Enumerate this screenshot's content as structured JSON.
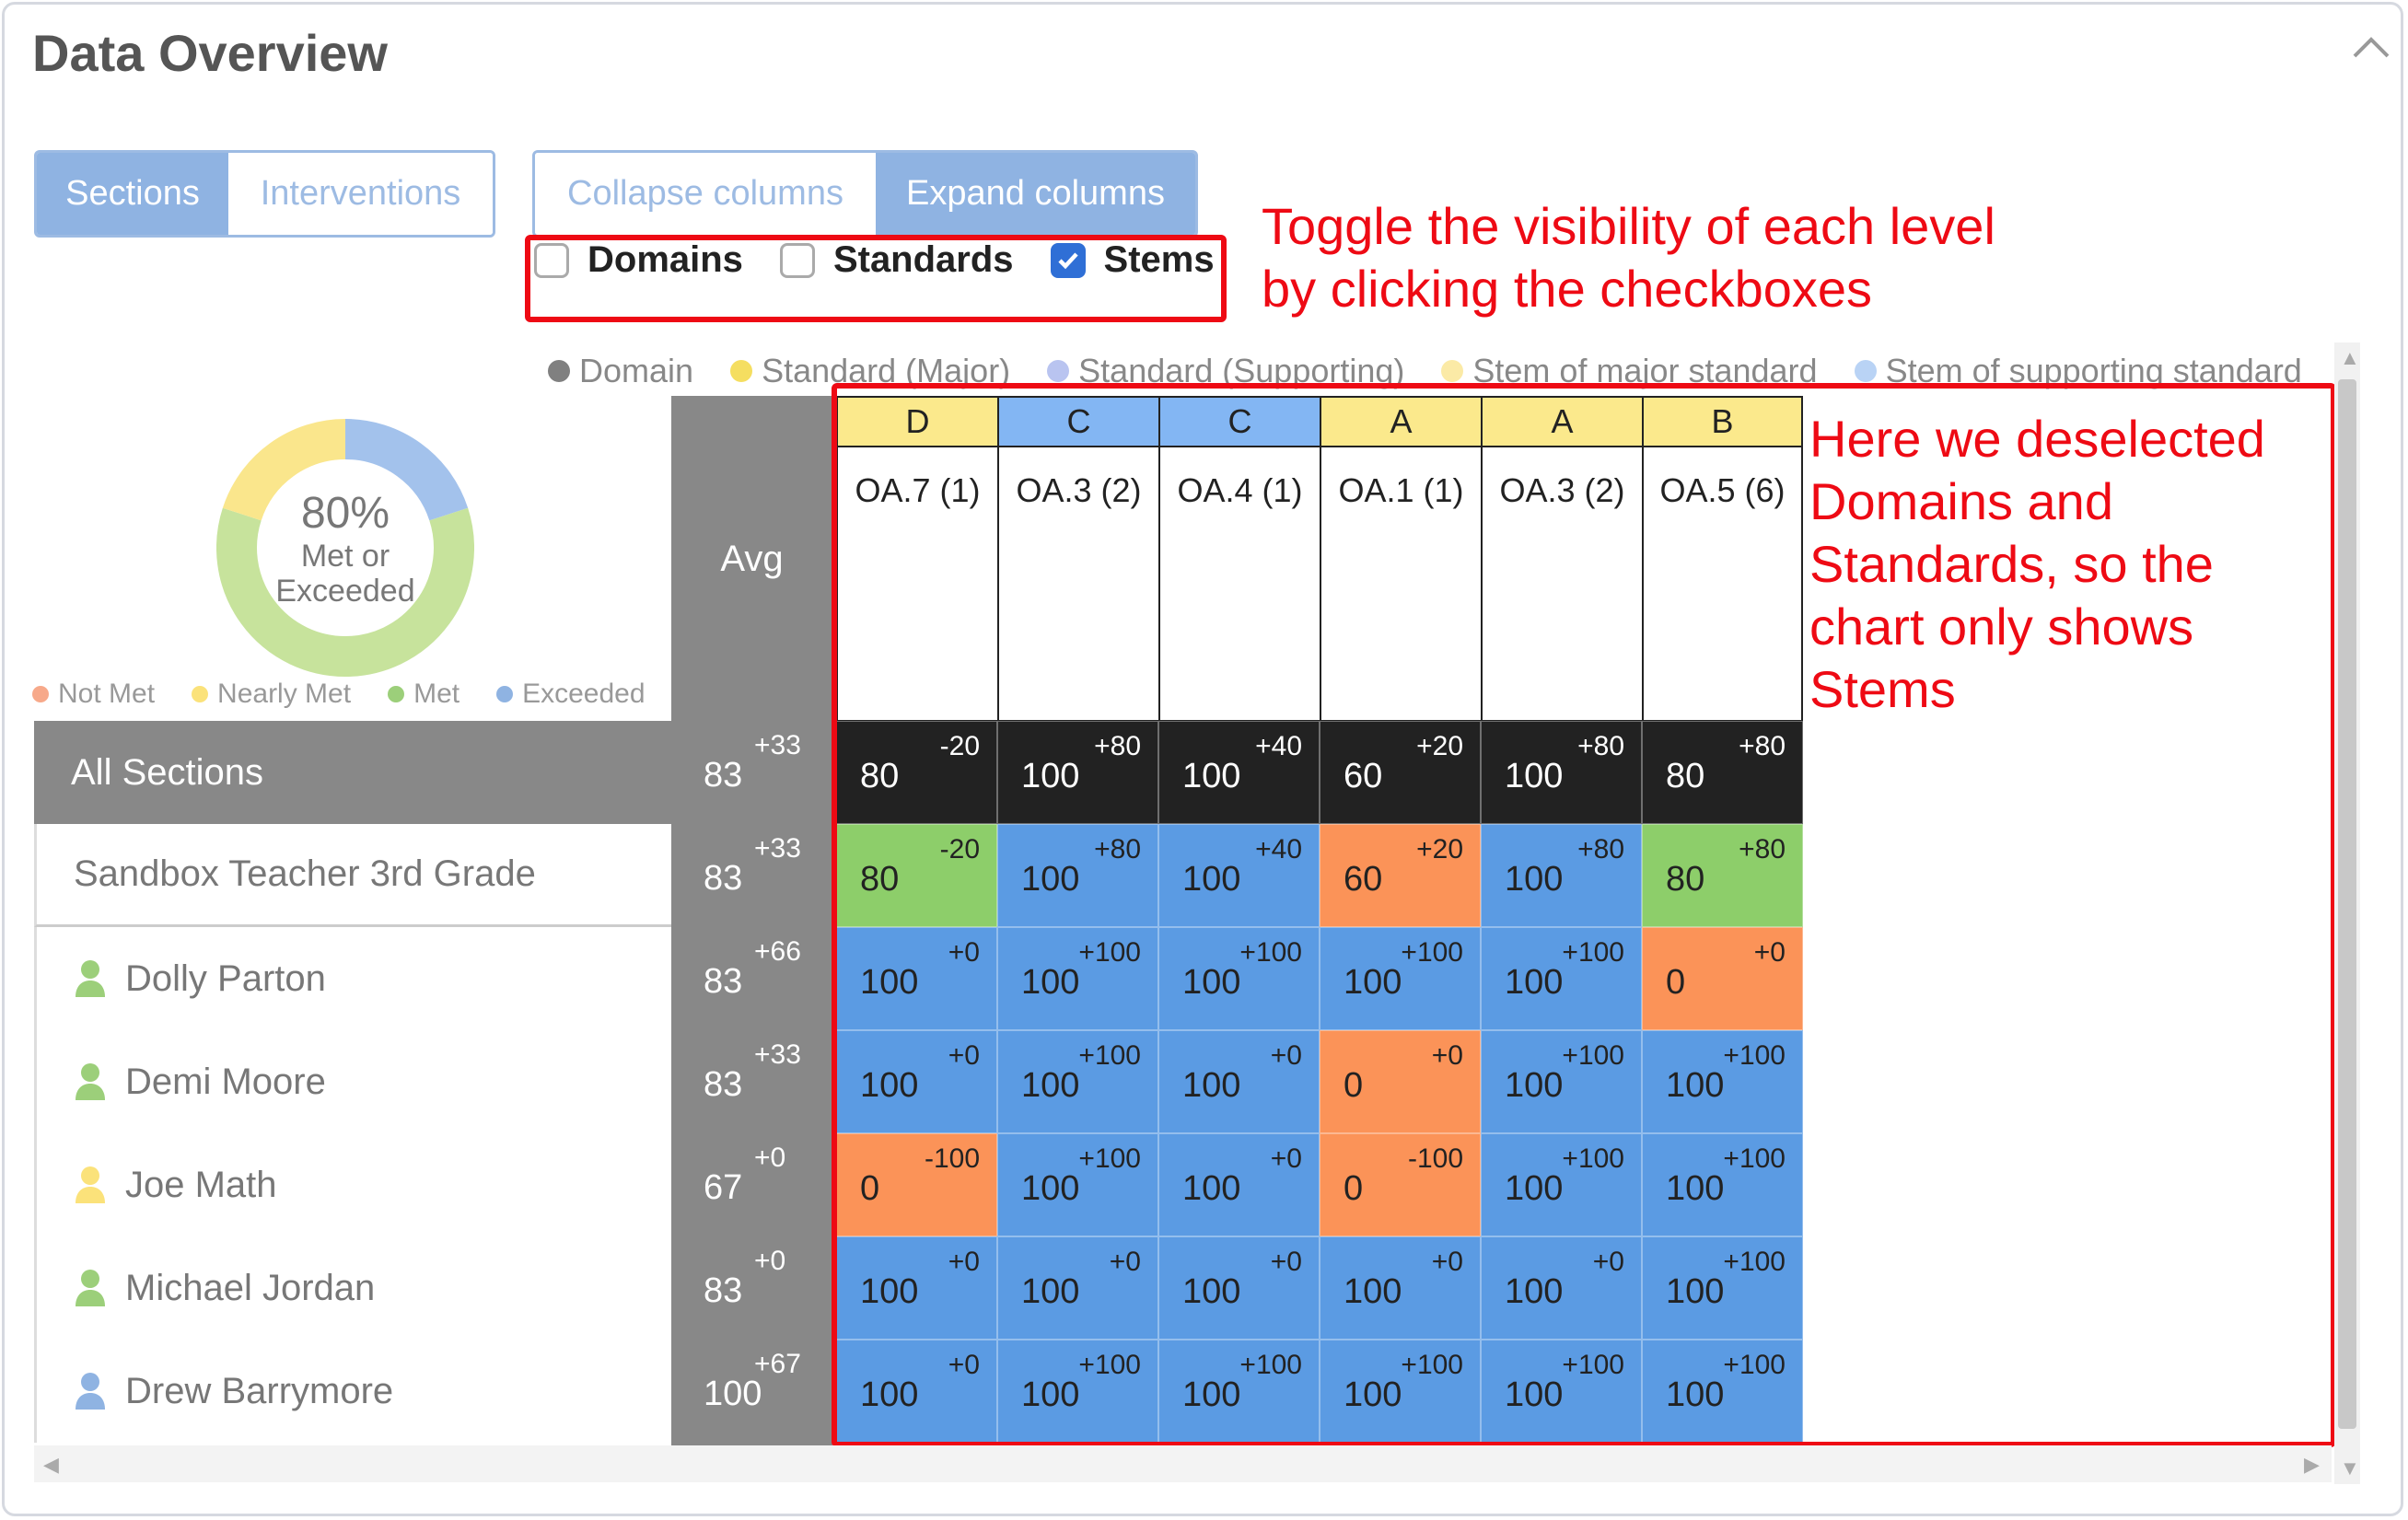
{
  "title": "Data Overview",
  "view_tabs": [
    {
      "label": "Sections",
      "active": true
    },
    {
      "label": "Interventions",
      "active": false
    }
  ],
  "column_tabs": [
    {
      "label": "Collapse columns",
      "active": false
    },
    {
      "label": "Expand columns",
      "active": true
    }
  ],
  "checkboxes": [
    {
      "label": "Domains",
      "checked": false
    },
    {
      "label": "Standards",
      "checked": false
    },
    {
      "label": "Stems",
      "checked": true
    }
  ],
  "annotations": {
    "toggle_line1": "Toggle the visibility of each level",
    "toggle_line2": "by clicking the checkboxes",
    "chart_lines": [
      "Here we deselected",
      "Domains and",
      "Standards, so the",
      "chart only shows",
      "Stems"
    ]
  },
  "level_legend": [
    {
      "label": "Domain",
      "color": "#808080"
    },
    {
      "label": "Standard (Major)",
      "color": "#f5de60"
    },
    {
      "label": "Standard (Supporting)",
      "color": "#b9c4f0"
    },
    {
      "label": "Stem of major standard",
      "color": "#fbeaa6"
    },
    {
      "label": "Stem of supporting standard",
      "color": "#b9d3f5"
    }
  ],
  "donut": {
    "percent_label": "80%",
    "sub_line1": "Met or",
    "sub_line2": "Exceeded",
    "segments": [
      {
        "name": "Exceeded",
        "fraction": 0.2,
        "color": "#a3c2ec"
      },
      {
        "name": "Met",
        "fraction": 0.6,
        "color": "#c7e39c"
      },
      {
        "name": "Nearly Met",
        "fraction": 0.2,
        "color": "#fae68c"
      }
    ]
  },
  "donut_legend": [
    {
      "label": "Not Met",
      "color": "#f7a98a"
    },
    {
      "label": "Nearly Met",
      "color": "#fbe27a"
    },
    {
      "label": "Met",
      "color": "#9ccf7a"
    },
    {
      "label": "Exceeded",
      "color": "#8fb3e2"
    }
  ],
  "avg_header": "Avg",
  "colors": {
    "met": "#8dce6a",
    "exceeded": "#5b9be3",
    "not_met": "#fb9358",
    "all_sections_row": "#222222",
    "header_yellow": "#fbe98c",
    "header_blue": "#83b6f3"
  },
  "columns": [
    {
      "letter": "D",
      "stem": "OA.7 (1)",
      "header_color": "#fbe98c"
    },
    {
      "letter": "C",
      "stem": "OA.3 (2)",
      "header_color": "#83b6f3"
    },
    {
      "letter": "C",
      "stem": "OA.4 (1)",
      "header_color": "#83b6f3"
    },
    {
      "letter": "A",
      "stem": "OA.1 (1)",
      "header_color": "#fbe98c"
    },
    {
      "letter": "A",
      "stem": "OA.3 (2)",
      "header_color": "#fbe98c"
    },
    {
      "letter": "B",
      "stem": "OA.5 (6)",
      "header_color": "#fbe98c"
    }
  ],
  "rows": [
    {
      "name": "All Sections",
      "kind": "all",
      "avg": "83",
      "avg_delta": "+33",
      "cells": [
        {
          "v": "80",
          "d": "-20",
          "s": "all"
        },
        {
          "v": "100",
          "d": "+80",
          "s": "all"
        },
        {
          "v": "100",
          "d": "+40",
          "s": "all"
        },
        {
          "v": "60",
          "d": "+20",
          "s": "all"
        },
        {
          "v": "100",
          "d": "+80",
          "s": "all"
        },
        {
          "v": "80",
          "d": "+80",
          "s": "all"
        }
      ]
    },
    {
      "name": "Sandbox Teacher 3rd Grade",
      "kind": "section",
      "avg": "83",
      "avg_delta": "+33",
      "cells": [
        {
          "v": "80",
          "d": "-20",
          "s": "met"
        },
        {
          "v": "100",
          "d": "+80",
          "s": "exceeded"
        },
        {
          "v": "100",
          "d": "+40",
          "s": "exceeded"
        },
        {
          "v": "60",
          "d": "+20",
          "s": "not_met"
        },
        {
          "v": "100",
          "d": "+80",
          "s": "exceeded"
        },
        {
          "v": "80",
          "d": "+80",
          "s": "met"
        }
      ]
    },
    {
      "name": "Dolly Parton",
      "kind": "student",
      "icon_color": "#9ccf7a",
      "avg": "83",
      "avg_delta": "+66",
      "cells": [
        {
          "v": "100",
          "d": "+0",
          "s": "exceeded"
        },
        {
          "v": "100",
          "d": "+100",
          "s": "exceeded"
        },
        {
          "v": "100",
          "d": "+100",
          "s": "exceeded"
        },
        {
          "v": "100",
          "d": "+100",
          "s": "exceeded"
        },
        {
          "v": "100",
          "d": "+100",
          "s": "exceeded"
        },
        {
          "v": "0",
          "d": "+0",
          "s": "not_met"
        }
      ]
    },
    {
      "name": "Demi Moore",
      "kind": "student",
      "icon_color": "#9ccf7a",
      "avg": "83",
      "avg_delta": "+33",
      "cells": [
        {
          "v": "100",
          "d": "+0",
          "s": "exceeded"
        },
        {
          "v": "100",
          "d": "+100",
          "s": "exceeded"
        },
        {
          "v": "100",
          "d": "+0",
          "s": "exceeded"
        },
        {
          "v": "0",
          "d": "+0",
          "s": "not_met"
        },
        {
          "v": "100",
          "d": "+100",
          "s": "exceeded"
        },
        {
          "v": "100",
          "d": "+100",
          "s": "exceeded"
        }
      ]
    },
    {
      "name": "Joe Math",
      "kind": "student",
      "icon_color": "#fbe27a",
      "avg": "67",
      "avg_delta": "+0",
      "cells": [
        {
          "v": "0",
          "d": "-100",
          "s": "not_met"
        },
        {
          "v": "100",
          "d": "+100",
          "s": "exceeded"
        },
        {
          "v": "100",
          "d": "+0",
          "s": "exceeded"
        },
        {
          "v": "0",
          "d": "-100",
          "s": "not_met"
        },
        {
          "v": "100",
          "d": "+100",
          "s": "exceeded"
        },
        {
          "v": "100",
          "d": "+100",
          "s": "exceeded"
        }
      ]
    },
    {
      "name": "Michael Jordan",
      "kind": "student",
      "icon_color": "#9ccf7a",
      "avg": "83",
      "avg_delta": "+0",
      "cells": [
        {
          "v": "100",
          "d": "+0",
          "s": "exceeded"
        },
        {
          "v": "100",
          "d": "+0",
          "s": "exceeded"
        },
        {
          "v": "100",
          "d": "+0",
          "s": "exceeded"
        },
        {
          "v": "100",
          "d": "+0",
          "s": "exceeded"
        },
        {
          "v": "100",
          "d": "+0",
          "s": "exceeded"
        },
        {
          "v": "100",
          "d": "+100",
          "s": "exceeded"
        }
      ]
    },
    {
      "name": "Drew Barrymore",
      "kind": "student",
      "icon_color": "#8fb3e2",
      "avg": "100",
      "avg_delta": "+67",
      "cells": [
        {
          "v": "100",
          "d": "+0",
          "s": "exceeded"
        },
        {
          "v": "100",
          "d": "+100",
          "s": "exceeded"
        },
        {
          "v": "100",
          "d": "+100",
          "s": "exceeded"
        },
        {
          "v": "100",
          "d": "+100",
          "s": "exceeded"
        },
        {
          "v": "100",
          "d": "+100",
          "s": "exceeded"
        },
        {
          "v": "100",
          "d": "+100",
          "s": "exceeded"
        }
      ]
    }
  ]
}
